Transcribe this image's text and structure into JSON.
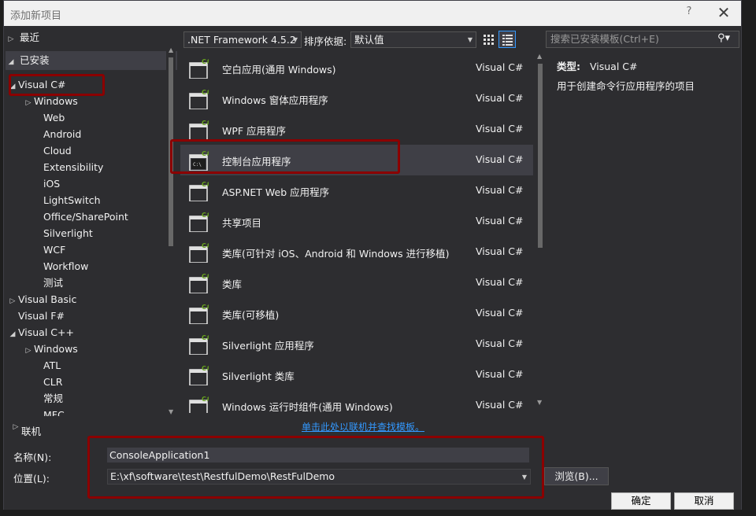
{
  "window": {
    "title": "添加新项目",
    "help": "?",
    "close": "✕"
  },
  "nav": {
    "recent": "最近",
    "installed": "已安装",
    "online": "联机",
    "items": [
      {
        "label": "Visual C#",
        "expander": "◢"
      },
      {
        "label": "Windows",
        "expander": "▷"
      },
      {
        "label": "Web",
        "expander": ""
      },
      {
        "label": "Android",
        "expander": ""
      },
      {
        "label": "Cloud",
        "expander": ""
      },
      {
        "label": "Extensibility",
        "expander": ""
      },
      {
        "label": "iOS",
        "expander": ""
      },
      {
        "label": "LightSwitch",
        "expander": ""
      },
      {
        "label": "Office/SharePoint",
        "expander": ""
      },
      {
        "label": "Silverlight",
        "expander": ""
      },
      {
        "label": "WCF",
        "expander": ""
      },
      {
        "label": "Workflow",
        "expander": ""
      },
      {
        "label": "测试",
        "expander": ""
      },
      {
        "label": "Visual Basic",
        "expander": "▷"
      },
      {
        "label": "Visual F#",
        "expander": ""
      },
      {
        "label": "Visual C++",
        "expander": "◢"
      },
      {
        "label": "Windows",
        "expander": "▷"
      },
      {
        "label": "ATL",
        "expander": ""
      },
      {
        "label": "CLR",
        "expander": ""
      },
      {
        "label": "常规",
        "expander": ""
      },
      {
        "label": "MFC",
        "expander": ""
      }
    ]
  },
  "toolbar": {
    "framework": ".NET Framework 4.5.2",
    "sort_label": "排序依据:",
    "sort_value": "默认值",
    "search_placeholder": "搜索已安装模板(Ctrl+E)"
  },
  "templates": [
    {
      "name": "空白应用(通用 Windows)",
      "lang": "Visual C#",
      "icon": "blank-app-icon"
    },
    {
      "name": "Windows 窗体应用程序",
      "lang": "Visual C#",
      "icon": "windows-forms-icon"
    },
    {
      "name": "WPF 应用程序",
      "lang": "Visual C#",
      "icon": "wpf-icon"
    },
    {
      "name": "控制台应用程序",
      "lang": "Visual C#",
      "icon": "console-app-icon"
    },
    {
      "name": "ASP.NET Web 应用程序",
      "lang": "Visual C#",
      "icon": "aspnet-icon"
    },
    {
      "name": "共享项目",
      "lang": "Visual C#",
      "icon": "shared-project-icon"
    },
    {
      "name": "类库(可针对 iOS、Android 和 Windows 进行移植)",
      "lang": "Visual C#",
      "icon": "portable-library-icon"
    },
    {
      "name": "类库",
      "lang": "Visual C#",
      "icon": "class-library-icon"
    },
    {
      "name": "类库(可移植)",
      "lang": "Visual C#",
      "icon": "portable-class-library-icon"
    },
    {
      "name": "Silverlight 应用程序",
      "lang": "Visual C#",
      "icon": "silverlight-app-icon"
    },
    {
      "name": "Silverlight 类库",
      "lang": "Visual C#",
      "icon": "silverlight-library-icon"
    },
    {
      "name": "Windows 运行时组件(通用 Windows)",
      "lang": "Visual C#",
      "icon": "winrt-component-icon"
    }
  ],
  "details": {
    "type_label": "类型:",
    "type_value": "Visual C#",
    "description": "用于创建命令行应用程序的项目"
  },
  "online_link": "单击此处以联机并查找模板。",
  "form": {
    "name_label": "名称(N):",
    "name_value": "ConsoleApplication1",
    "location_label": "位置(L):",
    "location_value": "E:\\xf\\software\\test\\RestfulDemo\\RestFulDemo",
    "browse": "浏览(B)...",
    "ok": "确定",
    "cancel": "取消"
  },
  "colors": {
    "accent": "#3399ff",
    "highlight": "#8b0000",
    "csharp_badge": "#68a51c"
  }
}
